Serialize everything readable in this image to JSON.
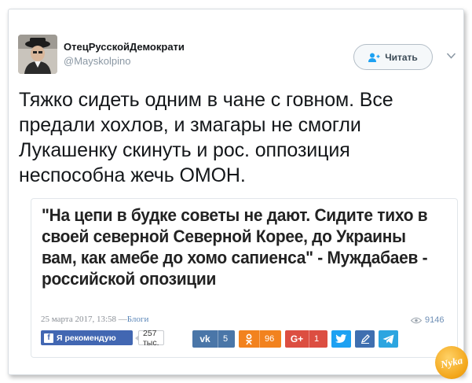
{
  "tweet": {
    "display_name": "ОтецРусскойДемократи",
    "handle": "@Mayskolpino",
    "follow_label": "Читать",
    "text": "Тяжко сидеть одним в чане с говном. Все предали хохлов, и змагары не смогли Лукашенку скинуть и рос. оппозиция неспособна жечь ОМОН.",
    "icons": {
      "follow": "add-user-icon",
      "menu": "chevron-down-icon"
    },
    "colors": {
      "text": "#14171a",
      "muted": "#8a97a3"
    }
  },
  "quote": {
    "headline": "\"На цепи в будке советы не дают. Сидите тихо в своей северной Северной Корее, до Украины вам, как амебе до хомо сапиенса\" - Муждабаев - российской опозиции",
    "date": "25 марта 2017, 13:58",
    "separator": "—",
    "category": "Блоги",
    "views": "9146",
    "share": {
      "facebook_label": "Я рекомендую",
      "facebook_count": "257 тыс.",
      "vk_count": "5",
      "ok_count": "96",
      "gplus_count": "1"
    },
    "colors": {
      "vk": "#4a76a8",
      "ok": "#f2821e",
      "gplus": "#dc4e41",
      "twitter": "#1da1f2",
      "mailru": "#3f6fb0",
      "telegram": "#2ca5e0",
      "facebook": "#4267b2"
    }
  },
  "watermark": {
    "text": "Nyka"
  }
}
